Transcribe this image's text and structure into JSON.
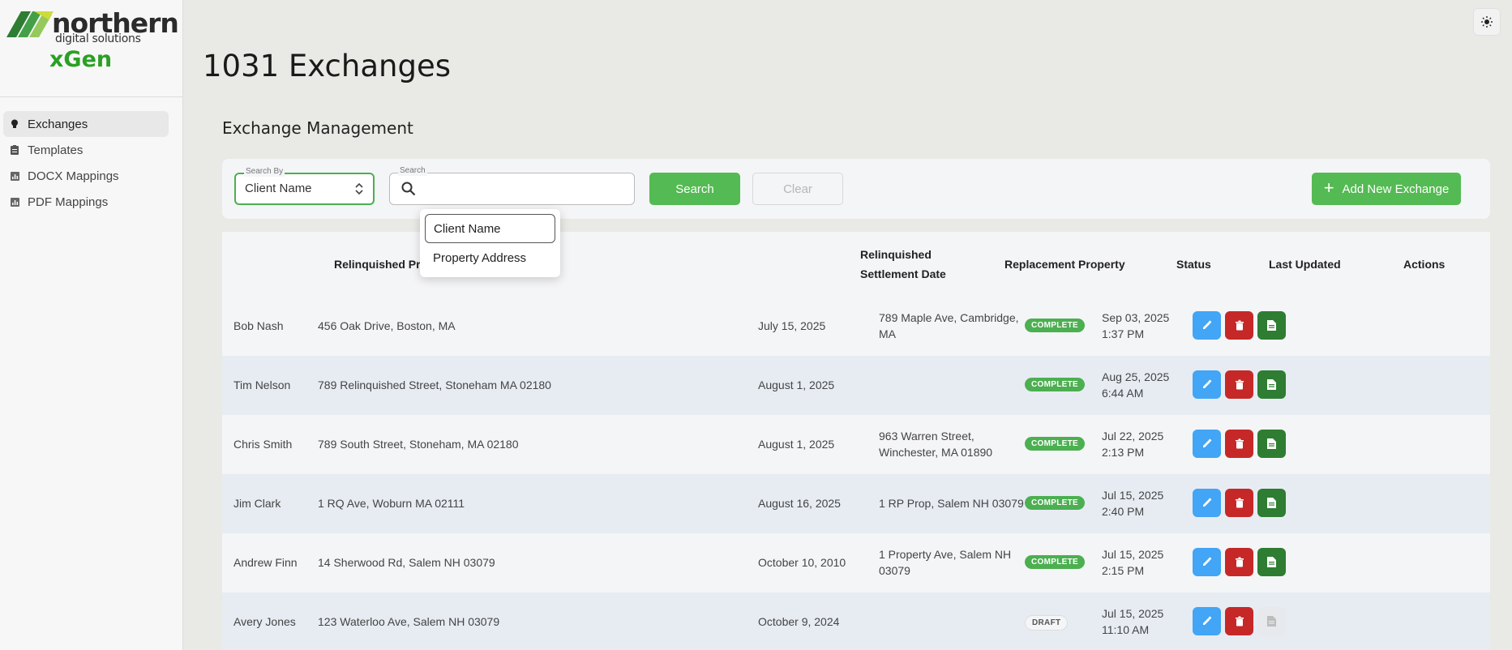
{
  "brand": {
    "name": "northern",
    "sub": "digital solutions",
    "product": "xGen"
  },
  "sidebar": {
    "items": [
      {
        "label": "Exchanges",
        "icon": "lightbulb-icon",
        "active": true
      },
      {
        "label": "Templates",
        "icon": "clipboard-icon",
        "active": false
      },
      {
        "label": "DOCX Mappings",
        "icon": "bar-chart-icon",
        "active": false
      },
      {
        "label": "PDF Mappings",
        "icon": "bar-chart-icon",
        "active": false
      }
    ]
  },
  "page": {
    "title": "1031 Exchanges",
    "section_title": "Exchange Management"
  },
  "search": {
    "search_by_label": "Search By",
    "search_by_value": "Client Name",
    "search_label": "Search",
    "search_value": "",
    "search_button": "Search",
    "clear_button": "Clear",
    "add_button": "Add New Exchange",
    "options": [
      "Client Name",
      "Property Address"
    ]
  },
  "table": {
    "headers": {
      "client": "",
      "relinquished": "Relinquished Property",
      "settlement_line1": "Relinquished",
      "settlement_line2": "Settlement Date",
      "replacement": "Replacement Property",
      "status": "Status",
      "updated": "Last Updated",
      "actions": "Actions"
    },
    "rows": [
      {
        "client": "Bob Nash",
        "relinquished": "456 Oak Drive, Boston, MA",
        "settlement": "July 15, 2025",
        "replacement_l1": "789 Maple Ave, Cambridge,",
        "replacement_l2": "MA",
        "status": "COMPLETE",
        "updated_date": "Sep 03, 2025",
        "updated_time": "1:37 PM"
      },
      {
        "client": "Tim Nelson",
        "relinquished": "789 Relinquished Street, Stoneham MA 02180",
        "settlement": "August 1, 2025",
        "replacement_l1": "",
        "replacement_l2": "",
        "status": "COMPLETE",
        "updated_date": "Aug 25, 2025",
        "updated_time": "6:44 AM"
      },
      {
        "client": "Chris Smith",
        "relinquished": "789 South Street, Stoneham, MA 02180",
        "settlement": "August 1, 2025",
        "replacement_l1": "963 Warren Street,",
        "replacement_l2": "Winchester, MA 01890",
        "status": "COMPLETE",
        "updated_date": "Jul 22, 2025",
        "updated_time": "2:13 PM"
      },
      {
        "client": "Jim Clark",
        "relinquished": "1 RQ Ave, Woburn MA 02111",
        "settlement": "August 16, 2025",
        "replacement_l1": "1 RP Prop, Salem NH 03079",
        "replacement_l2": "",
        "status": "COMPLETE",
        "updated_date": "Jul 15, 2025",
        "updated_time": "2:40 PM"
      },
      {
        "client": "Andrew Finn",
        "relinquished": "14 Sherwood Rd, Salem NH 03079",
        "settlement": "October 10, 2010",
        "replacement_l1": "1 Property Ave, Salem NH",
        "replacement_l2": "03079",
        "status": "COMPLETE",
        "updated_date": "Jul 15, 2025",
        "updated_time": "2:15 PM"
      },
      {
        "client": "Avery Jones",
        "relinquished": "123 Waterloo Ave, Salem NH 03079",
        "settlement": "October 9, 2024",
        "replacement_l1": "",
        "replacement_l2": "",
        "status": "DRAFT",
        "updated_date": "Jul 15, 2025",
        "updated_time": "11:10 AM"
      }
    ]
  },
  "colors": {
    "accent_green": "#54ba53",
    "brand_green": "#2aa024",
    "edit_blue": "#42a5f5",
    "delete_red": "#c62828",
    "doc_green": "#2e7d32"
  }
}
